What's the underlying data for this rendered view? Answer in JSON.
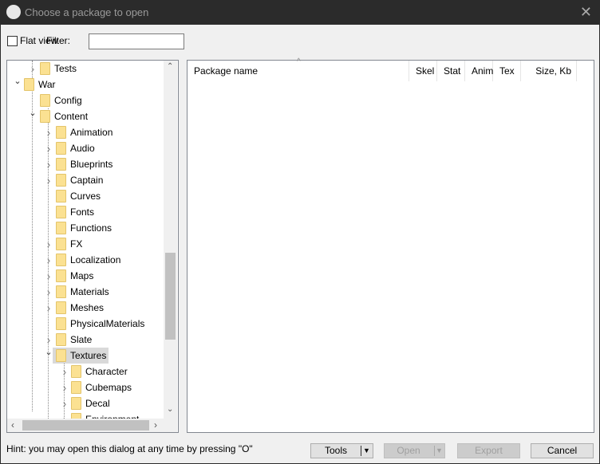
{
  "window": {
    "title": "Choose a package to open",
    "logo": "U"
  },
  "toolbar": {
    "flat_view_label": "Flat view",
    "flat_view_checked": false,
    "filter_label": "Filter:",
    "filter_value": ""
  },
  "tree": {
    "items": [
      {
        "label": "Tests",
        "level": 1,
        "expander": "collapsed"
      },
      {
        "label": "War",
        "level": 0,
        "expander": "expanded"
      },
      {
        "label": "Config",
        "level": 1,
        "expander": "none"
      },
      {
        "label": "Content",
        "level": 1,
        "expander": "expanded"
      },
      {
        "label": "Animation",
        "level": 2,
        "expander": "collapsed"
      },
      {
        "label": "Audio",
        "level": 2,
        "expander": "collapsed"
      },
      {
        "label": "Blueprints",
        "level": 2,
        "expander": "collapsed"
      },
      {
        "label": "Captain",
        "level": 2,
        "expander": "collapsed"
      },
      {
        "label": "Curves",
        "level": 2,
        "expander": "none"
      },
      {
        "label": "Fonts",
        "level": 2,
        "expander": "none"
      },
      {
        "label": "Functions",
        "level": 2,
        "expander": "none"
      },
      {
        "label": "FX",
        "level": 2,
        "expander": "collapsed"
      },
      {
        "label": "Localization",
        "level": 2,
        "expander": "collapsed"
      },
      {
        "label": "Maps",
        "level": 2,
        "expander": "collapsed"
      },
      {
        "label": "Materials",
        "level": 2,
        "expander": "collapsed"
      },
      {
        "label": "Meshes",
        "level": 2,
        "expander": "collapsed"
      },
      {
        "label": "PhysicalMaterials",
        "level": 2,
        "expander": "none"
      },
      {
        "label": "Slate",
        "level": 2,
        "expander": "collapsed"
      },
      {
        "label": "Textures",
        "level": 2,
        "expander": "expanded",
        "selected": true
      },
      {
        "label": "Character",
        "level": 3,
        "expander": "collapsed"
      },
      {
        "label": "Cubemaps",
        "level": 3,
        "expander": "collapsed"
      },
      {
        "label": "Decal",
        "level": 3,
        "expander": "collapsed"
      },
      {
        "label": "Environment",
        "level": 3,
        "expander": "collapsed"
      }
    ]
  },
  "list": {
    "columns": [
      "Package name",
      "Skel",
      "Stat",
      "Anim",
      "Tex",
      "Size, Kb"
    ],
    "sort_indicator": "^"
  },
  "footer": {
    "hint": "Hint: you may open this dialog at any time by pressing \"O\"",
    "tools": "Tools",
    "open": "Open",
    "export": "Export",
    "cancel": "Cancel"
  }
}
